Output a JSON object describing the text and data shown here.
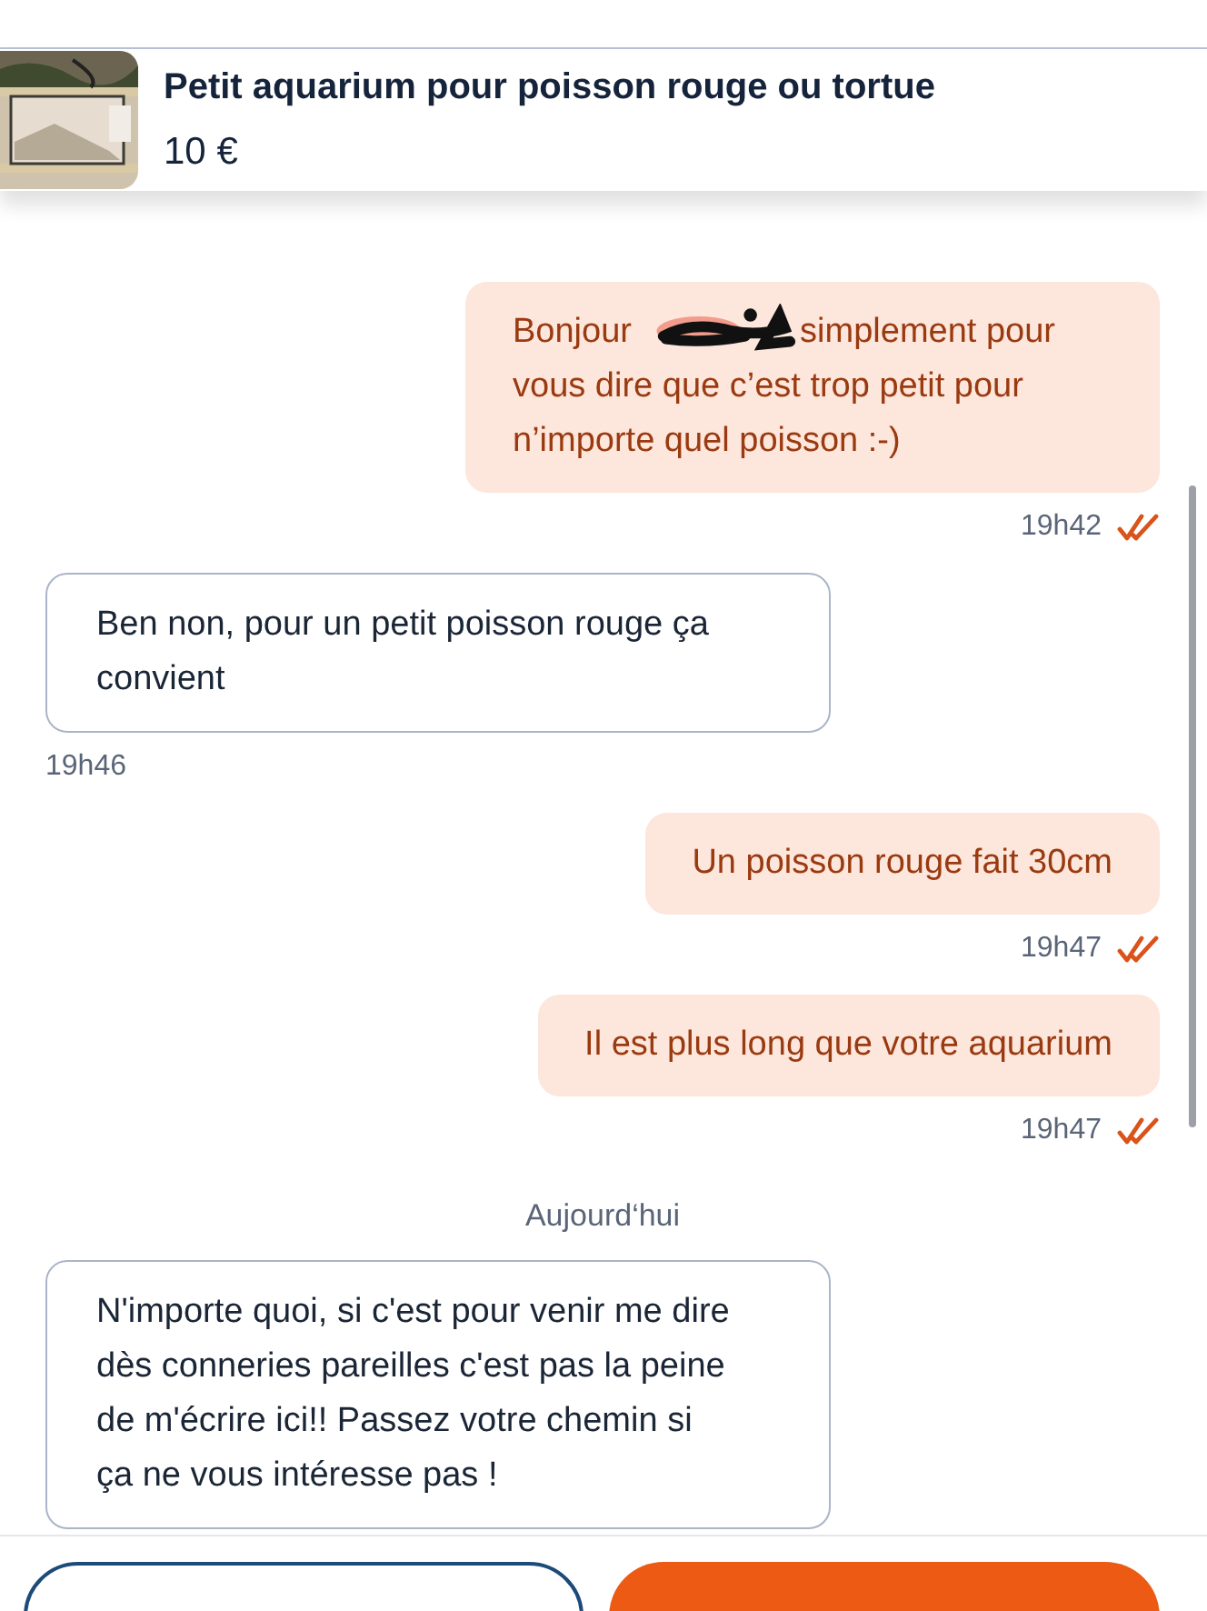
{
  "listing": {
    "title": "Petit aquarium pour poisson rouge ou tortue",
    "price": "10 €"
  },
  "messages": [
    {
      "kind": "gap"
    },
    {
      "kind": "sent",
      "text_before": "Bonjour",
      "redacted": true,
      "text": "simplement pour vous dire que c’est trop petit pour n’importe quel poisson :-)",
      "time": "19h42",
      "read": true
    },
    {
      "kind": "received",
      "text": "Ben non, pour un petit poisson rouge ça convient",
      "time": "19h46"
    },
    {
      "kind": "sent",
      "text": "Un poisson rouge fait 30cm",
      "time": "19h47",
      "read": true
    },
    {
      "kind": "sent",
      "text": "Il est plus long que votre aquarium",
      "time": "19h47",
      "read": true
    },
    {
      "kind": "date",
      "text": "Aujourd‘hui"
    },
    {
      "kind": "received",
      "text": "N'importe quoi, si c'est pour venir me dire dès conneries pareilles c'est pas la peine de m'écrire ici!! Passez votre chemin si ça ne vous intéresse pas !"
    }
  ],
  "actions": [
    {
      "kind": "secondary"
    },
    {
      "kind": "primary"
    }
  ]
}
